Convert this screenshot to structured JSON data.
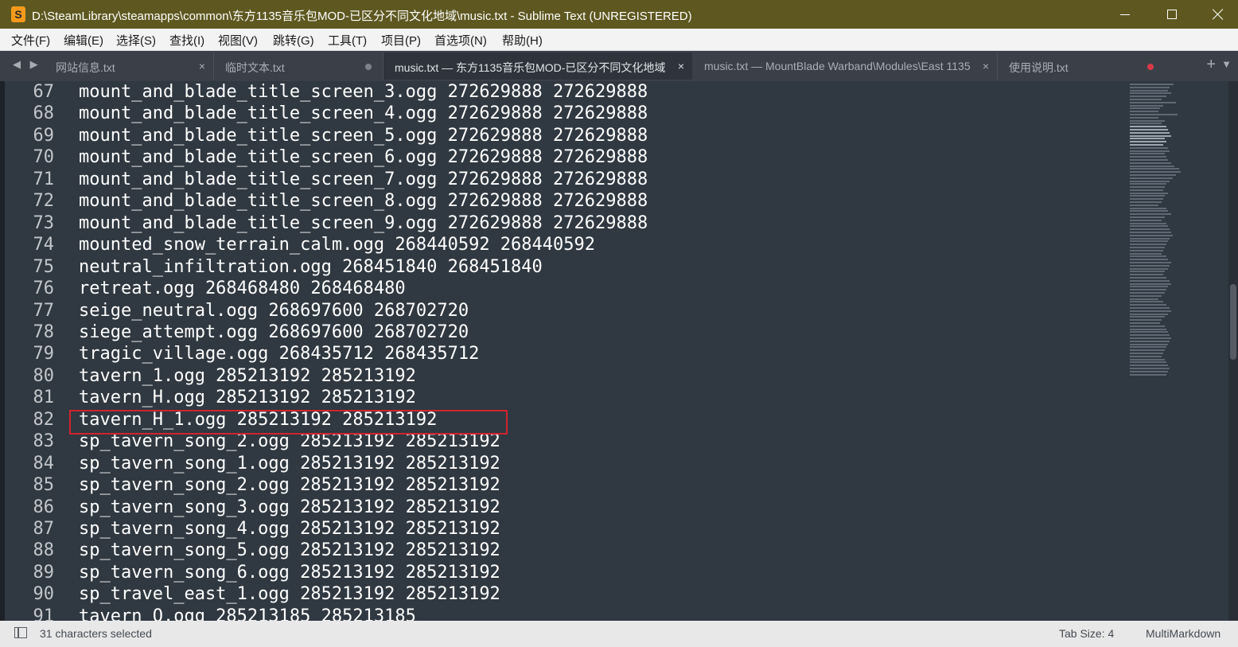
{
  "window": {
    "icon_letter": "S",
    "title": "D:\\SteamLibrary\\steamapps\\common\\东方1135音乐包MOD-已区分不同文化地域\\music.txt - Sublime Text (UNREGISTERED)"
  },
  "menu": [
    "文件(F)",
    "编辑(E)",
    "选择(S)",
    "查找(I)",
    "视图(V)",
    "跳转(G)",
    "工具(T)",
    "项目(P)",
    "首选项(N)",
    "帮助(H)"
  ],
  "nav_arrows": "◀ ▶",
  "tabs": [
    {
      "label": "网站信息.txt",
      "state": "close"
    },
    {
      "label": "临时文本.txt",
      "state": "dirty"
    },
    {
      "label": "music.txt — 东方1135音乐包MOD-已区分不同文化地域",
      "state": "close",
      "active": true
    },
    {
      "label": "music.txt — MountBlade Warband\\Modules\\East 1135",
      "state": "close"
    },
    {
      "label": "使用说明.txt",
      "state": "dirty-red"
    }
  ],
  "tab_close_glyph": "×",
  "tab_add_glyph": "+",
  "tab_menu_glyph": "▼",
  "editor": {
    "lines": [
      {
        "n": "67",
        "text": "mount_and_blade_title_screen_3.ogg 272629888 272629888"
      },
      {
        "n": "68",
        "text": "mount_and_blade_title_screen_4.ogg 272629888 272629888"
      },
      {
        "n": "69",
        "text": "mount_and_blade_title_screen_5.ogg 272629888 272629888"
      },
      {
        "n": "70",
        "text": "mount_and_blade_title_screen_6.ogg 272629888 272629888"
      },
      {
        "n": "71",
        "text": "mount_and_blade_title_screen_7.ogg 272629888 272629888"
      },
      {
        "n": "72",
        "text": "mount_and_blade_title_screen_8.ogg 272629888 272629888"
      },
      {
        "n": "73",
        "text": "mount_and_blade_title_screen_9.ogg 272629888 272629888"
      },
      {
        "n": "74",
        "text": "mounted_snow_terrain_calm.ogg 268440592 268440592"
      },
      {
        "n": "75",
        "text": "neutral_infiltration.ogg 268451840 268451840"
      },
      {
        "n": "76",
        "text": "retreat.ogg 268468480 268468480"
      },
      {
        "n": "77",
        "text": "seige_neutral.ogg 268697600 268702720"
      },
      {
        "n": "78",
        "text": "siege_attempt.ogg 268697600 268702720"
      },
      {
        "n": "79",
        "text": "tragic_village.ogg 268435712 268435712"
      },
      {
        "n": "80",
        "text": "tavern_1.ogg 285213192 285213192"
      },
      {
        "n": "81",
        "text": "tavern_H.ogg 285213192 285213192"
      },
      {
        "n": "82",
        "text": "tavern_H_1.ogg 285213192 285213192",
        "highlighted": true
      },
      {
        "n": "83",
        "text": "sp_tavern_song_2.ogg 285213192 285213192"
      },
      {
        "n": "84",
        "text": "sp_tavern_song_1.ogg 285213192 285213192"
      },
      {
        "n": "85",
        "text": "sp_tavern_song_2.ogg 285213192 285213192"
      },
      {
        "n": "86",
        "text": "sp_tavern_song_3.ogg 285213192 285213192"
      },
      {
        "n": "87",
        "text": "sp_tavern_song_4.ogg 285213192 285213192"
      },
      {
        "n": "88",
        "text": "sp_tavern_song_5.ogg 285213192 285213192"
      },
      {
        "n": "89",
        "text": "sp_tavern_song_6.ogg 285213192 285213192"
      },
      {
        "n": "90",
        "text": "sp_travel_east_1.ogg 285213192 285213192"
      },
      {
        "n": "91",
        "text": "tavern_O.ogg 285213185 285213185"
      }
    ]
  },
  "status": {
    "selection": "31 characters selected",
    "tab_size": "Tab Size: 4",
    "syntax": "MultiMarkdown"
  },
  "colors": {
    "titlebar": "#5e5820",
    "editor_bg": "#303841",
    "highlight_border": "#d0242e",
    "dirty_red": "#d8394a"
  }
}
